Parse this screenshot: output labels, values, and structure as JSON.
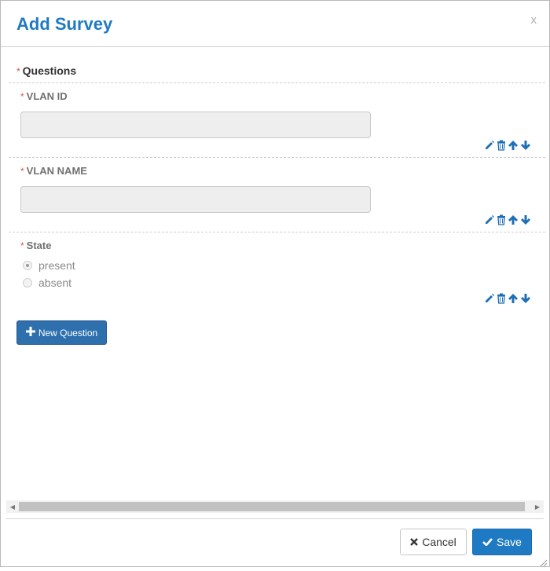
{
  "modal": {
    "title": "Add Survey",
    "close_label": "x"
  },
  "questions": {
    "title": "Questions",
    "required_marker": "*",
    "items": [
      {
        "label": "VLAN ID",
        "type": "text",
        "value": ""
      },
      {
        "label": "VLAN NAME",
        "type": "text",
        "value": ""
      },
      {
        "label": "State",
        "type": "radio",
        "options": [
          {
            "label": "present",
            "checked": true
          },
          {
            "label": "absent",
            "checked": false
          }
        ]
      }
    ],
    "action_icons": [
      "pencil-icon",
      "trash-icon",
      "arrow-up-icon",
      "arrow-down-icon"
    ]
  },
  "new_question_button": {
    "label": "New Question"
  },
  "footer": {
    "cancel_label": "Cancel",
    "save_label": "Save"
  },
  "colors": {
    "title": "#1f7ac4",
    "primary": "#1f7ac4",
    "new_question": "#2e6fad",
    "required": "#d9534f"
  }
}
